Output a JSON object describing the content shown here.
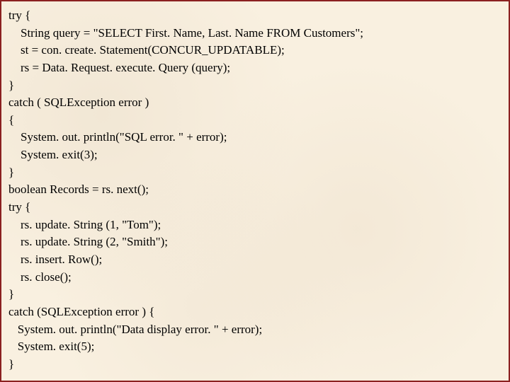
{
  "code": {
    "lines": [
      "try {",
      "    String query = \"SELECT First. Name, Last. Name FROM Customers\";",
      "    st = con. create. Statement(CONCUR_UPDATABLE);",
      "    rs = Data. Request. execute. Query (query);",
      "}",
      "catch ( SQLException error )",
      "{",
      "    System. out. println(\"SQL error. \" + error);",
      "    System. exit(3);",
      "}",
      "boolean Records = rs. next();",
      "try {",
      "    rs. update. String (1, \"Tom\");",
      "    rs. update. String (2, \"Smith\");",
      "    rs. insert. Row();",
      "    rs. close();",
      "}",
      "catch (SQLException error ) {",
      "   System. out. println(\"Data display error. \" + error);",
      "   System. exit(5);",
      "}"
    ]
  }
}
